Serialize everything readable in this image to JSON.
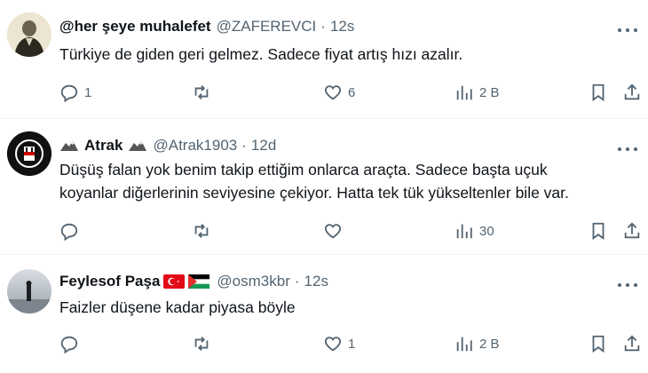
{
  "tweets": [
    {
      "name": "@her şeye muhalefet",
      "handle": "@ZAFEREVCI",
      "separator": "·",
      "time": "12s",
      "text": "Türkiye de giden geri gelmez. Sadece fiyat artış hızı azalır.",
      "replies": "1",
      "retweets": "",
      "likes": "6",
      "views": "2 B"
    },
    {
      "name": "Atrak",
      "handle": "@Atrak1903",
      "separator": "·",
      "time": "12d",
      "text_line1": "Düşüş falan yok benim takip ettiğim onlarca araçta. Sadece başta uçuk",
      "text_line2": "koyanlar diğerlerinin seviyesine çekiyor. Hatta tek tük yükseltenler bile var.",
      "replies": "",
      "retweets": "",
      "likes": "",
      "views": "30"
    },
    {
      "name": "Feylesof Paşa",
      "handle": "@osm3kbr",
      "separator": "·",
      "time": "12s",
      "text": "Faizler düşene kadar piyasa böyle",
      "replies": "",
      "retweets": "",
      "likes": "1",
      "views": "2 B"
    }
  ],
  "icons": {
    "reply": "reply-icon",
    "retweet": "retweet-icon",
    "like": "heart-icon",
    "views": "views-bar-chart-icon",
    "bookmark": "bookmark-icon",
    "share": "share-icon",
    "more": "more-dots-icon"
  },
  "colors": {
    "text": "#0f1419",
    "secondary": "#536471",
    "divider": "#eff3f4"
  }
}
